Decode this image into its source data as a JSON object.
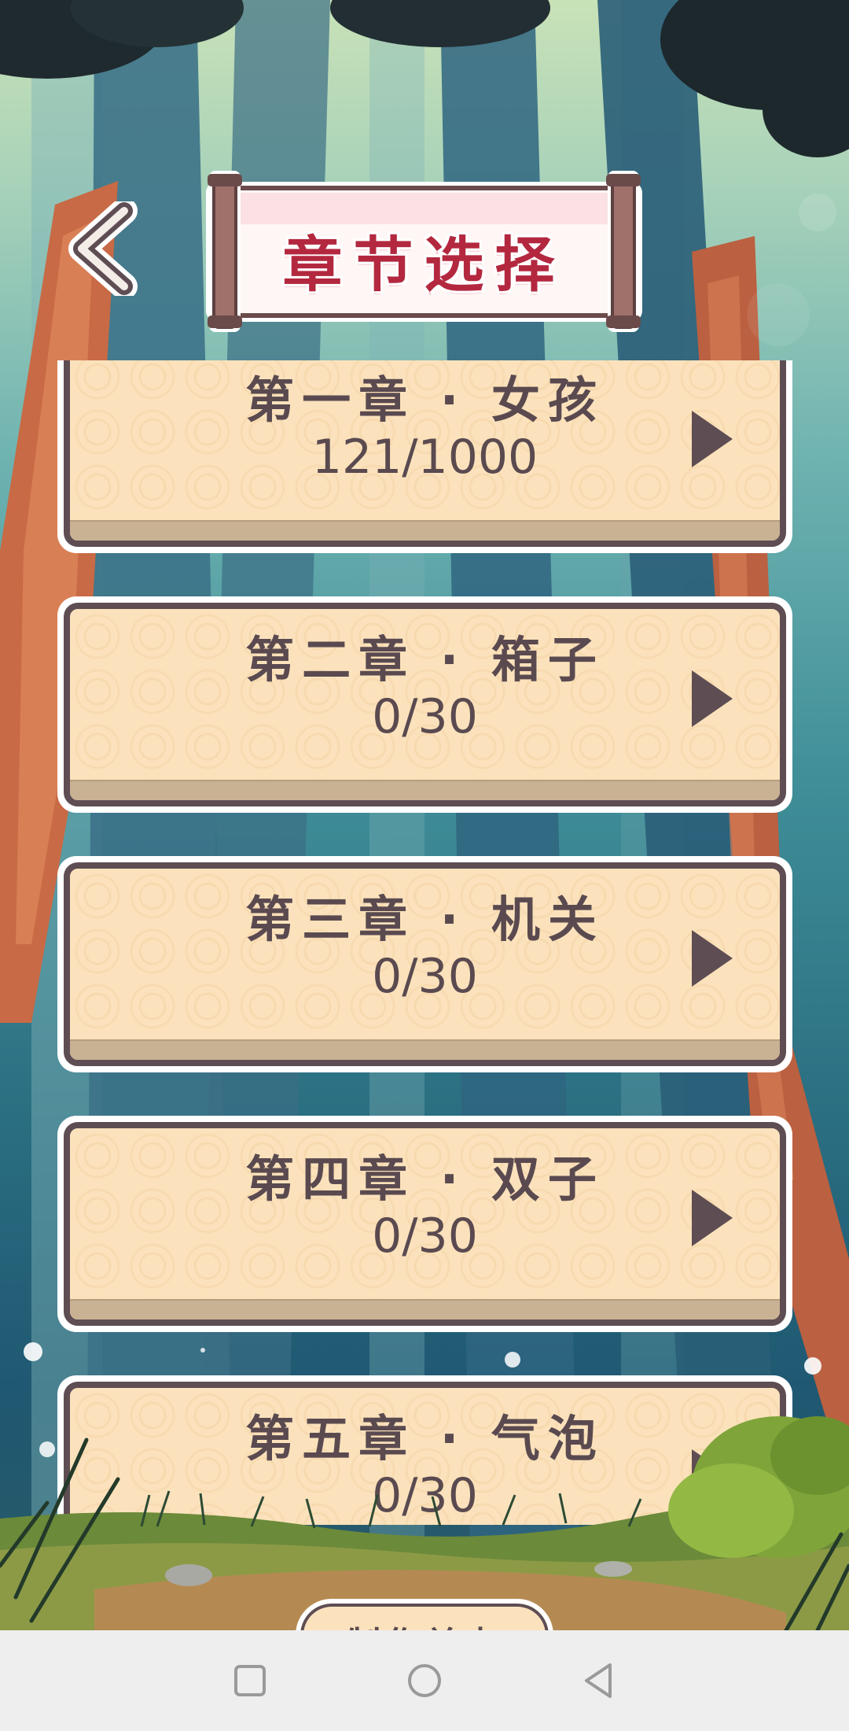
{
  "header": {
    "title": "章节选择",
    "back_icon": "chevron-left-icon"
  },
  "chapters": [
    {
      "title": "第一章 · 女孩",
      "progress": "121/1000"
    },
    {
      "title": "第二章 · 箱子",
      "progress": "0/30"
    },
    {
      "title": "第三章 · 机关",
      "progress": "0/30"
    },
    {
      "title": "第四章 · 双子",
      "progress": "0/30"
    },
    {
      "title": "第五章 · 气泡",
      "progress": "0/30"
    }
  ],
  "footer": {
    "maker_button_label": "制作关卡"
  },
  "nav_bar": {
    "recent_icon": "square-icon",
    "home_icon": "circle-icon",
    "back_icon": "triangle-back-icon"
  },
  "colors": {
    "title_red": "#b3283f",
    "card_fill": "#fbe2bc",
    "card_border": "#5e4d53",
    "text_dark": "#5a4a50"
  }
}
